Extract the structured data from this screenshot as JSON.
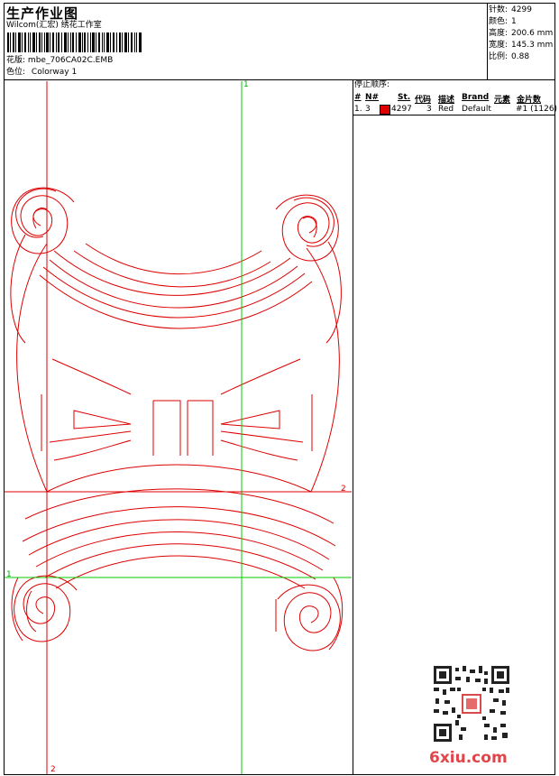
{
  "header": {
    "title": "生产作业图",
    "subtitle": "Wilcom(汇宏) 绣花工作室",
    "design_label": "花版:",
    "design_value": "mbe_706CA02C.EMB",
    "colorway_label": "色位:",
    "colorway_value": "Colorway 1"
  },
  "stats": [
    {
      "label": "针数:",
      "value": "4299"
    },
    {
      "label": "颜色:",
      "value": "1"
    },
    {
      "label": "高度:",
      "value": "200.6 mm"
    },
    {
      "label": "宽度:",
      "value": "145.3 mm"
    },
    {
      "label": "比例:",
      "value": "0.88"
    }
  ],
  "stop_sequence": {
    "title": "停止顺序:",
    "columns": [
      "#",
      "N#",
      "St.",
      "代码",
      "描述",
      "Brand",
      "元素",
      "金片数"
    ],
    "rows": [
      {
        "num": "1.",
        "n": "3",
        "code": "4297",
        "stitches": "3",
        "desc": "Red",
        "brand": "Default",
        "elements": "#1 (1126)"
      }
    ]
  },
  "guides": {
    "green_v_label": "1",
    "green_h_label": "1",
    "red_h_label": "2",
    "red_v_label": "2"
  },
  "colors": {
    "stitch": "#dd0000",
    "guide_green": "#00cc00",
    "guide_red": "#dd0000"
  },
  "watermark": {
    "text": "6xiu.com"
  }
}
